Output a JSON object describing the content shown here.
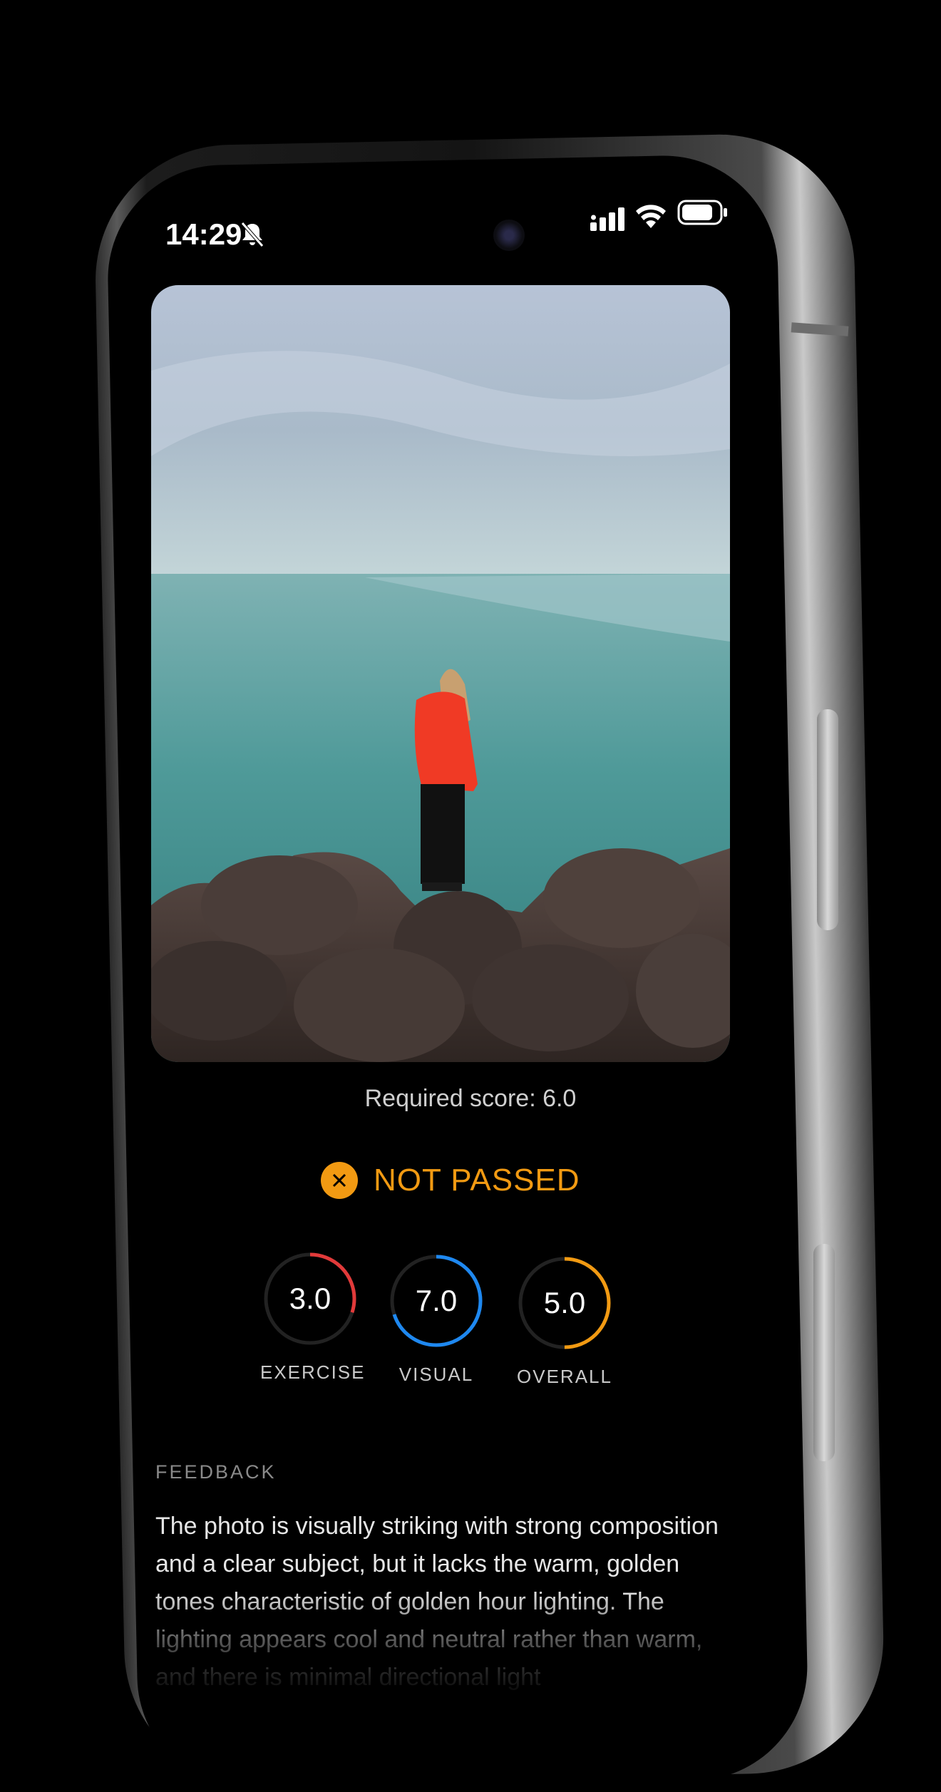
{
  "status_bar": {
    "time": "14:29"
  },
  "photo": {
    "alt": "Person in red jacket standing on rocks facing the sea"
  },
  "required_score_text": "Required score: 6.0",
  "result": {
    "label": "NOT PASSED",
    "color": "#f29a12"
  },
  "scores": [
    {
      "label": "EXERCISE",
      "value": "3.0",
      "fraction": 0.3,
      "color": "#e23a3a"
    },
    {
      "label": "VISUAL",
      "value": "7.0",
      "fraction": 0.7,
      "color": "#1e88f0"
    },
    {
      "label": "OVERALL",
      "value": "5.0",
      "fraction": 0.5,
      "color": "#f29a12"
    }
  ],
  "feedback": {
    "heading": "FEEDBACK",
    "text": "The photo is visually striking with strong composition and a clear subject, but it lacks the warm, golden tones characteristic of golden hour lighting. The lighting appears cool and neutral rather than warm, and there is minimal directional light"
  },
  "icons": {
    "bell": "bell-slash-icon",
    "signal": "cellular-signal-icon",
    "wifi": "wifi-icon",
    "battery": "battery-icon",
    "x": "close-icon"
  }
}
